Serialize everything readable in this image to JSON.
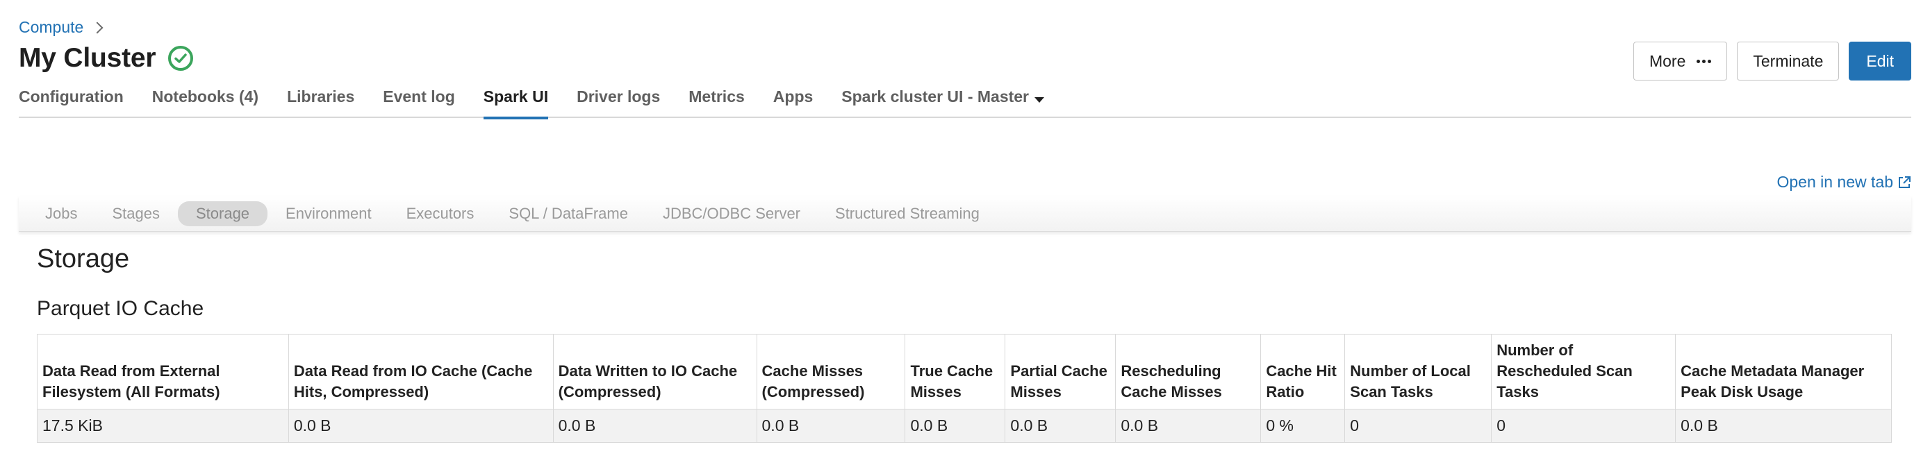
{
  "breadcrumb": {
    "parent": "Compute"
  },
  "page": {
    "title": "My Cluster"
  },
  "actions": {
    "more": "More",
    "terminate": "Terminate",
    "edit": "Edit"
  },
  "tabs": [
    {
      "label": "Configuration"
    },
    {
      "label": "Notebooks (4)"
    },
    {
      "label": "Libraries"
    },
    {
      "label": "Event log"
    },
    {
      "label": "Spark UI"
    },
    {
      "label": "Driver logs"
    },
    {
      "label": "Metrics"
    },
    {
      "label": "Apps"
    },
    {
      "label": "Spark cluster UI - Master"
    }
  ],
  "active_tab": "Spark UI",
  "open_link": "Open in new tab",
  "spark_nav": [
    {
      "label": "Jobs"
    },
    {
      "label": "Stages"
    },
    {
      "label": "Storage"
    },
    {
      "label": "Environment"
    },
    {
      "label": "Executors"
    },
    {
      "label": "SQL / DataFrame"
    },
    {
      "label": "JDBC/ODBC Server"
    },
    {
      "label": "Structured Streaming"
    }
  ],
  "storage": {
    "heading": "Storage",
    "subheading": "Parquet IO Cache",
    "columns": [
      "Data Read from External Filesystem (All Formats)",
      "Data Read from IO Cache (Cache Hits, Compressed)",
      "Data Written to IO Cache (Compressed)",
      "Cache Misses (Compressed)",
      "True Cache Misses",
      "Partial Cache Misses",
      "Rescheduling Cache Misses",
      "Cache Hit Ratio",
      "Number of Local Scan Tasks",
      "Number of Rescheduled Scan Tasks",
      "Cache Metadata Manager Peak Disk Usage"
    ],
    "rows": [
      [
        "17.5 KiB",
        "0.0 B",
        "0.0 B",
        "0.0 B",
        "0.0 B",
        "0.0 B",
        "0.0 B",
        "0 %",
        "0",
        "0",
        "0.0 B"
      ]
    ]
  },
  "colors": {
    "accent": "#2272b4",
    "status_ok": "#3ba55c"
  }
}
